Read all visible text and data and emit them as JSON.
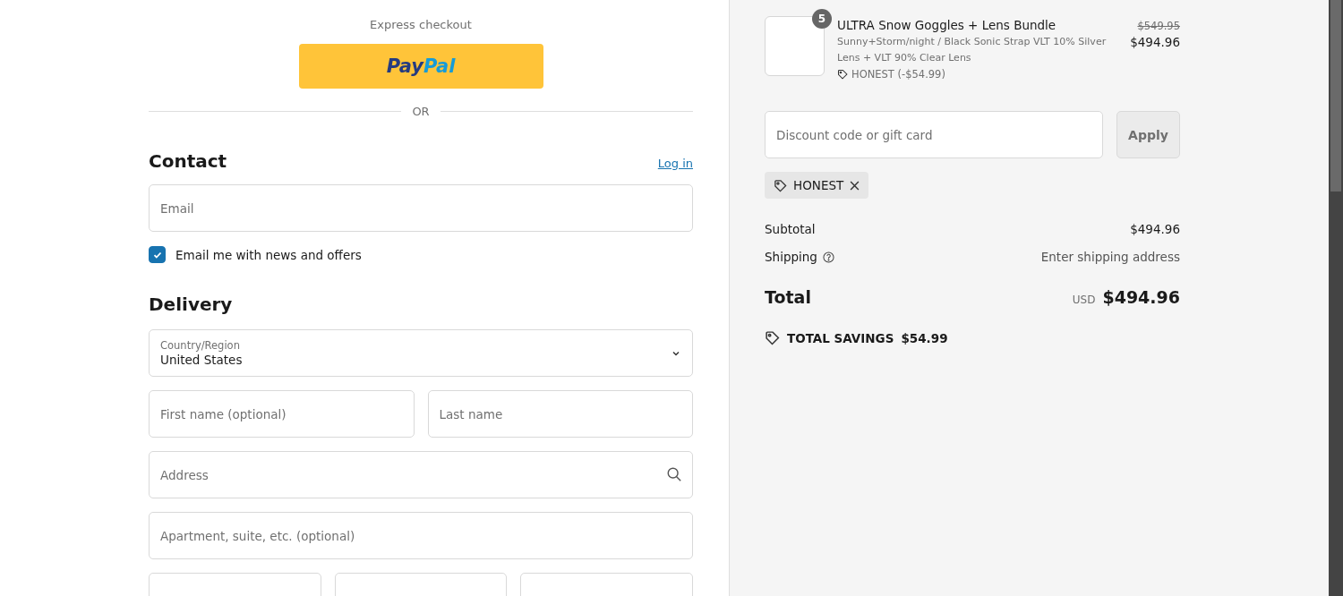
{
  "express_checkout": {
    "title": "Express checkout",
    "paypal_logo": [
      "Pay",
      "Pal"
    ],
    "divider": "OR"
  },
  "contact": {
    "heading": "Contact",
    "login_link": "Log in",
    "email": {
      "placeholder": "Email"
    },
    "newsletter": {
      "label": "Email me with news and offers",
      "checked": true
    }
  },
  "delivery": {
    "heading": "Delivery",
    "country": {
      "label": "Country/Region",
      "value": "United States"
    },
    "fields": [
      {
        "kind": "pair",
        "items": [
          {
            "placeholder": "First name (optional)"
          },
          {
            "placeholder": "Last name"
          }
        ]
      },
      {
        "kind": "search",
        "placeholder": "Address"
      },
      {
        "kind": "single",
        "placeholder": "Apartment, suite, etc. (optional)"
      },
      {
        "kind": "triple",
        "items": [
          {
            "kind": "text"
          },
          {
            "kind": "text"
          },
          {
            "kind": "text"
          }
        ]
      }
    ]
  },
  "summary": {
    "product": {
      "quantity": "5",
      "name": "ULTRA Snow Goggles + Lens Bundle",
      "variant": "Sunny+Storm/night / Black Sonic Strap VLT 10% Silver Lens + VLT 90% Clear Lens",
      "discount": "HONEST (-$54.99)",
      "original_price": "$549.95",
      "price": "$494.96"
    },
    "discount_field": {
      "placeholder": "Discount code or gift card"
    },
    "apply_button": "Apply",
    "applied_codes": [
      "HONEST"
    ],
    "subtotal": {
      "label": "Subtotal",
      "value": "$494.96"
    },
    "shipping": {
      "label": "Shipping",
      "value": "Enter shipping address"
    },
    "total": {
      "label": "Total",
      "currency": "USD",
      "value": "$494.96"
    },
    "savings": {
      "label": "TOTAL SAVINGS",
      "value": "$54.99"
    }
  }
}
